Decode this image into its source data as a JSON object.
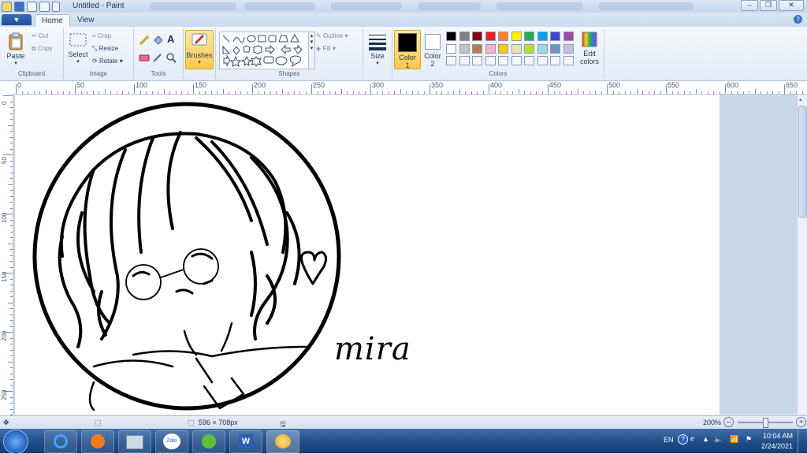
{
  "window": {
    "title": "Untitled - Paint"
  },
  "tabs": {
    "file": "▼",
    "home": "Home",
    "view": "View"
  },
  "clipboard": {
    "paste": "Paste",
    "cut": "Cut",
    "copy": "Copy",
    "label": "Clipboard"
  },
  "image": {
    "select": "Select",
    "crop": "Crop",
    "resize": "Resize",
    "rotate": "Rotate",
    "label": "Image"
  },
  "tools": {
    "label": "Tools",
    "text_tool": "A"
  },
  "brushes": {
    "label": "Brushes"
  },
  "shapes": {
    "outline": "Outline",
    "fill": "Fill",
    "label": "Shapes"
  },
  "size": {
    "label": "Size"
  },
  "colors": {
    "color1": "Color 1",
    "color1_line1": "Color",
    "color1_line2": "1",
    "color2_line1": "Color",
    "color2_line2": "2",
    "edit_line1": "Edit",
    "edit_line2": "colors",
    "label": "Colors",
    "color1_value": "#000000",
    "color2_value": "#ffffff",
    "palette": [
      "#000000",
      "#7f7f7f",
      "#880015",
      "#ed1c24",
      "#ff7f27",
      "#fff200",
      "#22b14c",
      "#00a2e8",
      "#3f48cc",
      "#a349a4",
      "#ffffff",
      "#c3c3c3",
      "#b97a57",
      "#ffaec9",
      "#ffc90e",
      "#efe4b0",
      "#b5e61d",
      "#99d9ea",
      "#7092be",
      "#c8bfe7"
    ]
  },
  "ruler": {
    "h_labels": [
      "0",
      "50",
      "100",
      "150",
      "200",
      "250",
      "300",
      "350",
      "400",
      "450",
      "500",
      "550",
      "600",
      "650"
    ],
    "v_labels": [
      "0",
      "50",
      "100",
      "150",
      "200",
      "250"
    ]
  },
  "canvas": {
    "signature": "mira"
  },
  "status": {
    "dimensions": "596 × 708px",
    "zoom": "200%"
  },
  "taskbar": {
    "language": "EN",
    "time": "10:04 AM",
    "date": "2/24/2021",
    "apps": [
      "start-orb",
      "internet-explorer",
      "media-player",
      "file-explorer",
      "zalo",
      "app-g",
      "word",
      "paint"
    ],
    "zalo_label": "Zalo"
  }
}
